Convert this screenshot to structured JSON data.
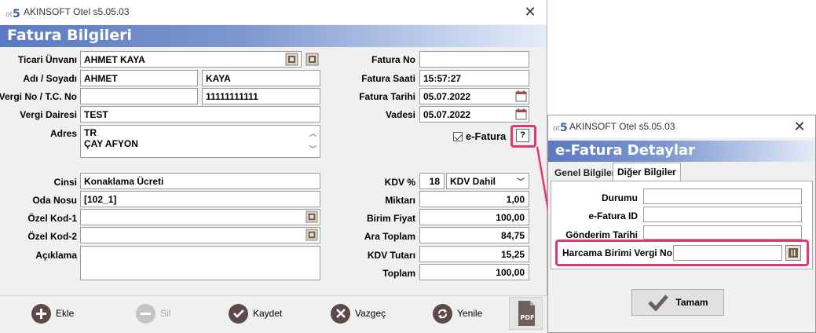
{
  "main": {
    "window_title": "AKINSOFT Otel s5.05.03",
    "header": "Fatura Bilgileri",
    "labels": {
      "ticari_unvani": "Ticari Ünvanı",
      "adi_soyadi": "Adı / Soyadı",
      "vergi_no": "Vergi No / T.C. No",
      "vergi_dairesi": "Vergi Dairesi",
      "adres": "Adres",
      "cinsi": "Cinsi",
      "oda_nosu": "Oda Nosu",
      "ozel_kod1": "Özel Kod-1",
      "ozel_kod2": "Özel Kod-2",
      "aciklama": "Açıklama",
      "fatura_no": "Fatura No",
      "fatura_saati": "Fatura Saati",
      "fatura_tarihi": "Fatura Tarihi",
      "vadesi": "Vadesi",
      "kdv_yuzde": "KDV %",
      "miktari": "Miktarı",
      "birim_fiyat": "Birim Fiyat",
      "ara_toplam": "Ara Toplam",
      "kdv_tutari": "KDV Tutarı",
      "toplam": "Toplam"
    },
    "values": {
      "ticari_unvani": "AHMET KAYA",
      "adi": "AHMET",
      "soyadi": "KAYA",
      "vergi_no": "",
      "tc_no": "11111111111",
      "vergi_dairesi": "TEST",
      "adres_line1": "TR",
      "adres_line2": "ÇAY AFYON",
      "cinsi": "Konaklama Ücreti",
      "oda_nosu": "[102_1]",
      "ozel_kod1": "",
      "ozel_kod2": "",
      "aciklama": "",
      "fatura_no": "",
      "fatura_saati": "15:57:27",
      "fatura_tarihi": "05.07.2022",
      "vadesi": "05.07.2022",
      "kdv_oran": "18",
      "kdv_tipi": "KDV Dahil",
      "miktari": "1,00",
      "birim_fiyat": "100,00",
      "ara_toplam": "84,75",
      "kdv_tutari": "15,25",
      "toplam": "100,00"
    },
    "efatura_label": "e-Fatura",
    "efatura_checked": true,
    "help_label": "?",
    "toolbar": {
      "ekle": "Ekle",
      "sil": "Sil",
      "kaydet": "Kaydet",
      "vazgec": "Vazgeç",
      "yenile": "Yenile"
    }
  },
  "dialog": {
    "window_title": "AKINSOFT Otel s5.05.03",
    "header": "e-Fatura Detaylar",
    "tabs": [
      "Genel Bilgiler",
      "Diğer Bilgiler"
    ],
    "active_tab": "Diğer Bilgiler",
    "labels": {
      "durumu": "Durumu",
      "efatura_id": "e-Fatura ID",
      "gonderim_tarihi": "Gönderim Tarihi",
      "harcama_birimi": "Harcama Birimi Vergi No"
    },
    "ok_label": "Tamam"
  },
  "colors": {
    "header_gradient_start": "#5b79c0",
    "highlight": "#e03a6a",
    "toolbar_icon": "#5c4a4a"
  }
}
